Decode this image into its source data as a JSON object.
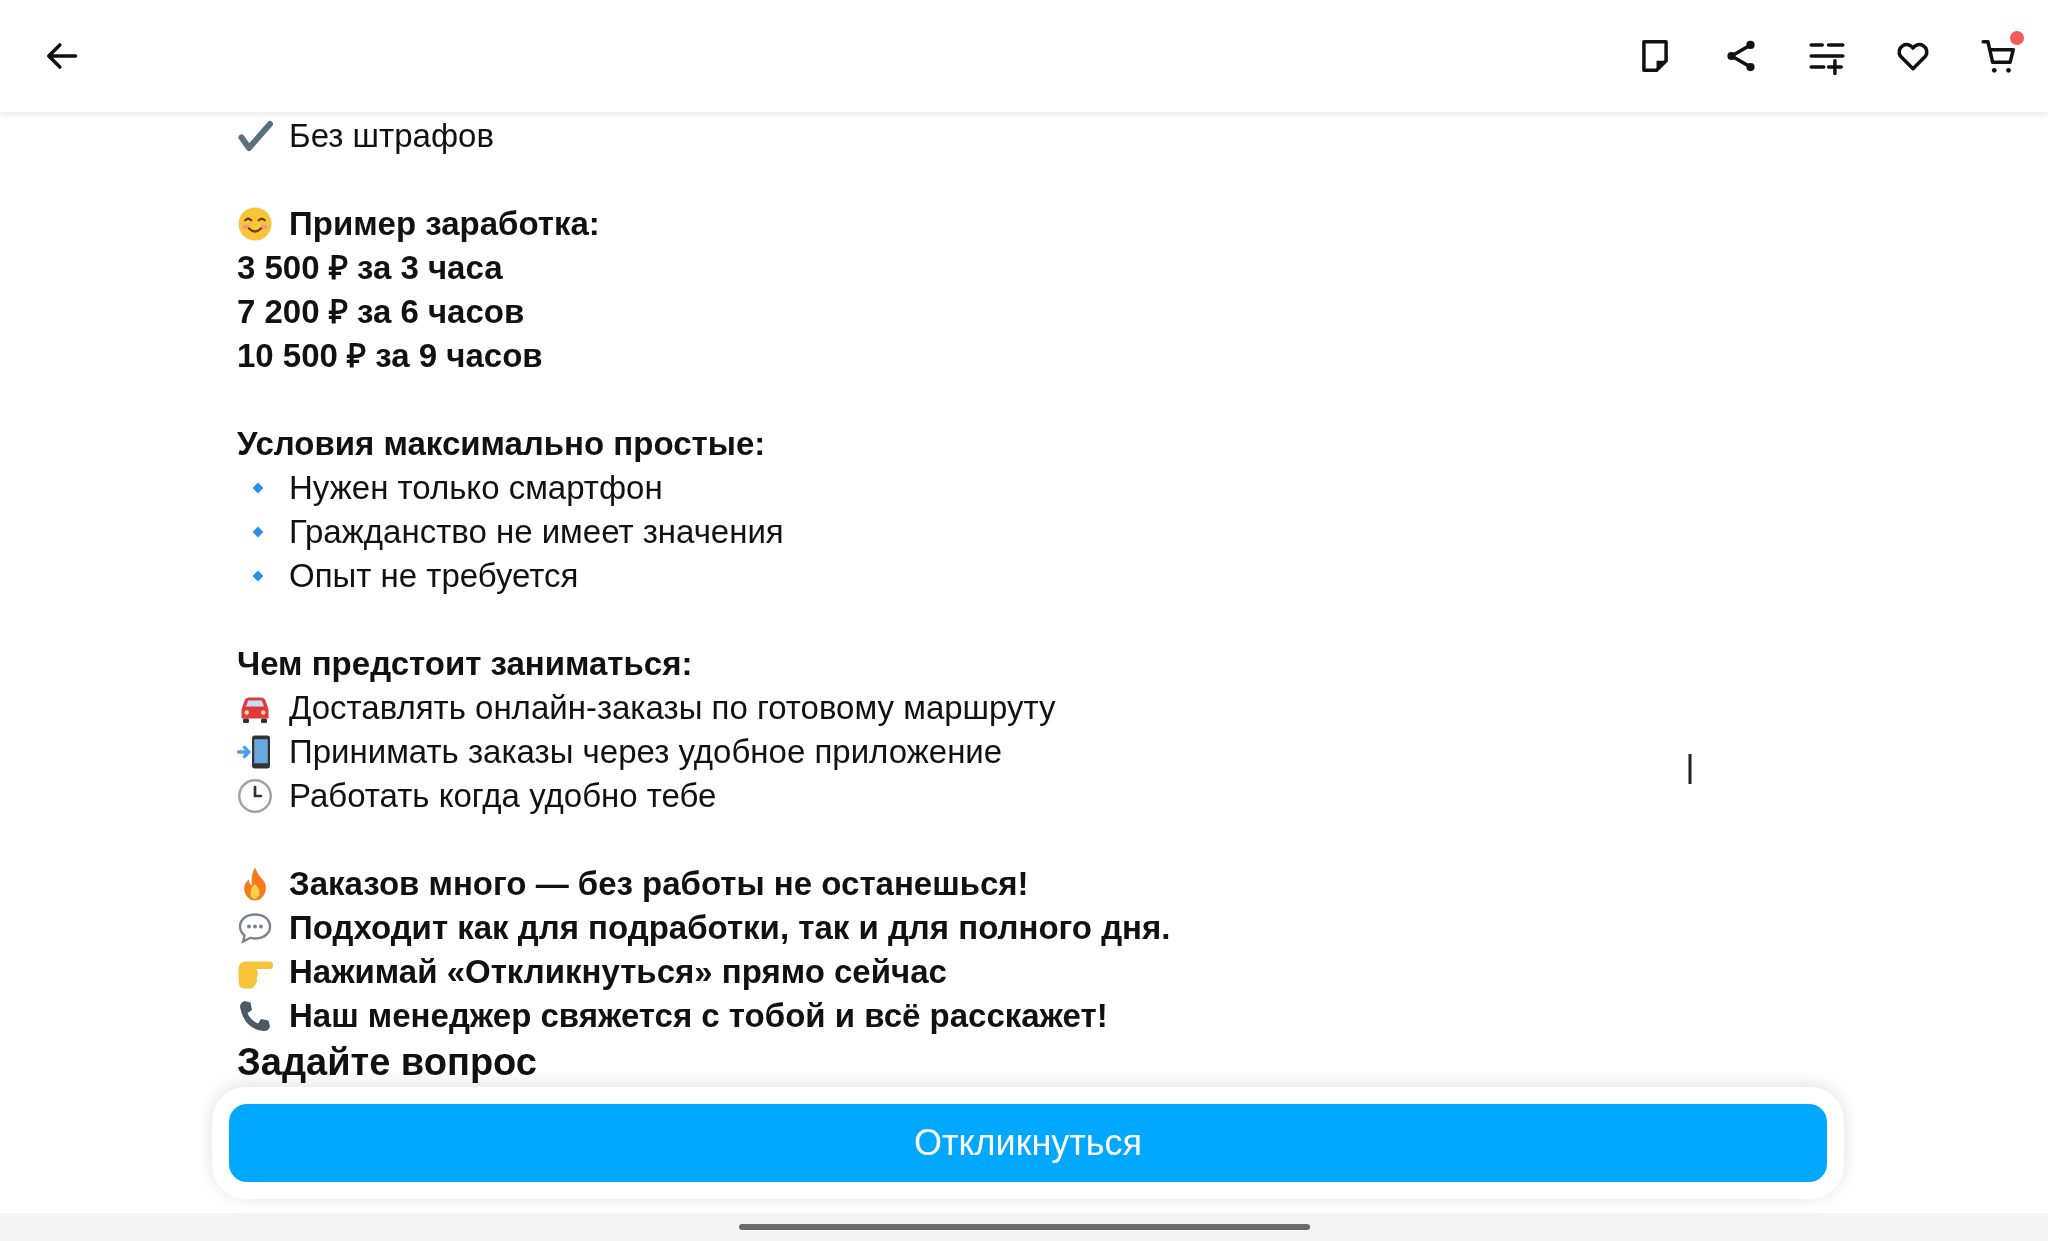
{
  "header": {
    "cart_badge": true
  },
  "content": [
    {
      "kind": "check",
      "bold": false,
      "text": "Без штрафов"
    },
    {
      "kind": "blank"
    },
    {
      "kind": "smile",
      "bold": true,
      "text": "Пример заработка:"
    },
    {
      "kind": "plain",
      "bold": true,
      "text": "3 500 ₽ за 3 часа"
    },
    {
      "kind": "plain",
      "bold": true,
      "text": "7 200 ₽ за 6 часов"
    },
    {
      "kind": "plain",
      "bold": true,
      "text": "10 500 ₽ за 9 часов"
    },
    {
      "kind": "blank"
    },
    {
      "kind": "plain",
      "bold": true,
      "text": "Условия максимально простые:"
    },
    {
      "kind": "diamond",
      "bold": false,
      "text": "Нужен только смартфон"
    },
    {
      "kind": "diamond",
      "bold": false,
      "text": "Гражданство не имеет значения"
    },
    {
      "kind": "diamond",
      "bold": false,
      "text": "Опыт не требуется"
    },
    {
      "kind": "blank"
    },
    {
      "kind": "plain",
      "bold": true,
      "text": "Чем предстоит заниматься:"
    },
    {
      "kind": "car",
      "bold": false,
      "text": "Доставлять онлайн-заказы по готовому маршруту"
    },
    {
      "kind": "phone",
      "bold": false,
      "text": "Принимать заказы через удобное приложение"
    },
    {
      "kind": "clock",
      "bold": false,
      "text": "Работать когда удобно тебе"
    },
    {
      "kind": "blank"
    },
    {
      "kind": "fire",
      "bold": true,
      "text": "Заказов много — без работы не останешься!"
    },
    {
      "kind": "speech",
      "bold": true,
      "text": "Подходит как для подработки, так и для полного дня."
    },
    {
      "kind": "hand",
      "bold": true,
      "text": "Нажимай «Откликнуться» прямо сейчас"
    },
    {
      "kind": "telephone",
      "bold": true,
      "text": "Наш менеджер свяжется с тобой и всё расскажет!"
    }
  ],
  "next_heading": "Задайте вопрос",
  "action_button": {
    "label": "Откликнуться"
  }
}
